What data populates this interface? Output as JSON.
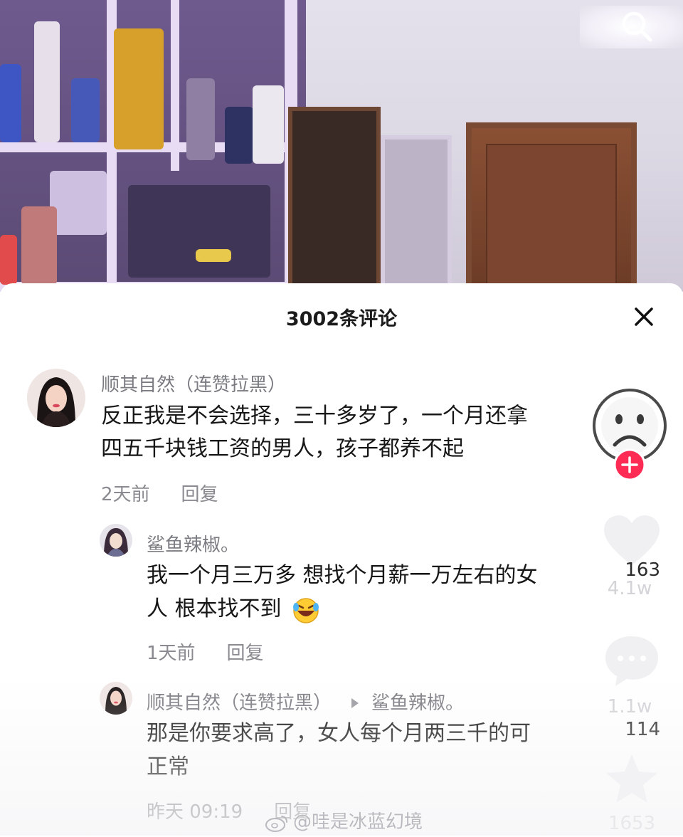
{
  "header": {
    "title": "3002条评论"
  },
  "comments": [
    {
      "username": "顺其自然（连赞拉黑）",
      "text_line1": "反正我是不会选择，三十多岁了，一个月还拿",
      "text_line2": "四五千块钱工资的男人，孩子都养不起",
      "time": "2天前",
      "reply_label": "回复"
    },
    {
      "username": "鲨鱼辣椒。",
      "text_line1": "我一个月三万多 想找个月薪一万左右的女",
      "text_line2": "人 根本找不到",
      "time": "1天前",
      "reply_label": "回复",
      "like_count": "163"
    },
    {
      "username": "顺其自然（连赞拉黑）",
      "reply_to": "鲨鱼辣椒。",
      "text_line1": "那是你要求高了，女人每个月两三千的可",
      "text_line2": "正常",
      "time": "昨天 09:19",
      "reply_label": "回复",
      "like_count": "114"
    }
  ],
  "side_actions": {
    "likes": "4.1w",
    "comments": "1.1w",
    "favorites": "1653"
  },
  "watermark": "@哇是冰蓝幻境",
  "colors": {
    "accent_red": "#fe2c55",
    "username_gray": "#7b7b82",
    "meta_gray": "#8a8a90"
  },
  "icons": [
    "search-icon",
    "close-icon",
    "heart-icon",
    "comment-bubble-icon",
    "star-icon",
    "plus-icon",
    "laughing-emoji-icon",
    "weibo-logo-icon"
  ]
}
